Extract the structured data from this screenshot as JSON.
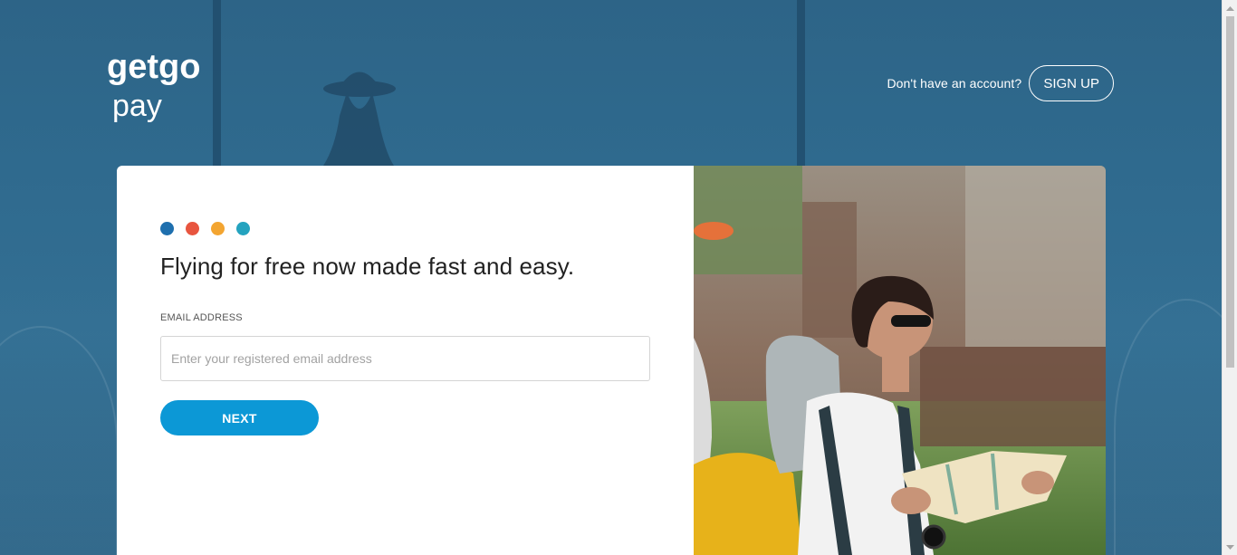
{
  "brand": {
    "logo_line1": "getgo",
    "logo_line2": "pay"
  },
  "header": {
    "account_prompt": "Don't have an account?",
    "signup_label": "SIGN UP"
  },
  "login": {
    "dots": [
      {
        "color": "#1e6fae"
      },
      {
        "color": "#e8553f"
      },
      {
        "color": "#f3a531"
      },
      {
        "color": "#24a3bf"
      }
    ],
    "headline": "Flying for free now made fast and easy.",
    "email_label": "EMAIL ADDRESS",
    "email_placeholder": "Enter your registered email address",
    "email_value": "",
    "next_label": "NEXT"
  },
  "colors": {
    "background": "#2f6a8e",
    "accent": "#0c98d6"
  }
}
